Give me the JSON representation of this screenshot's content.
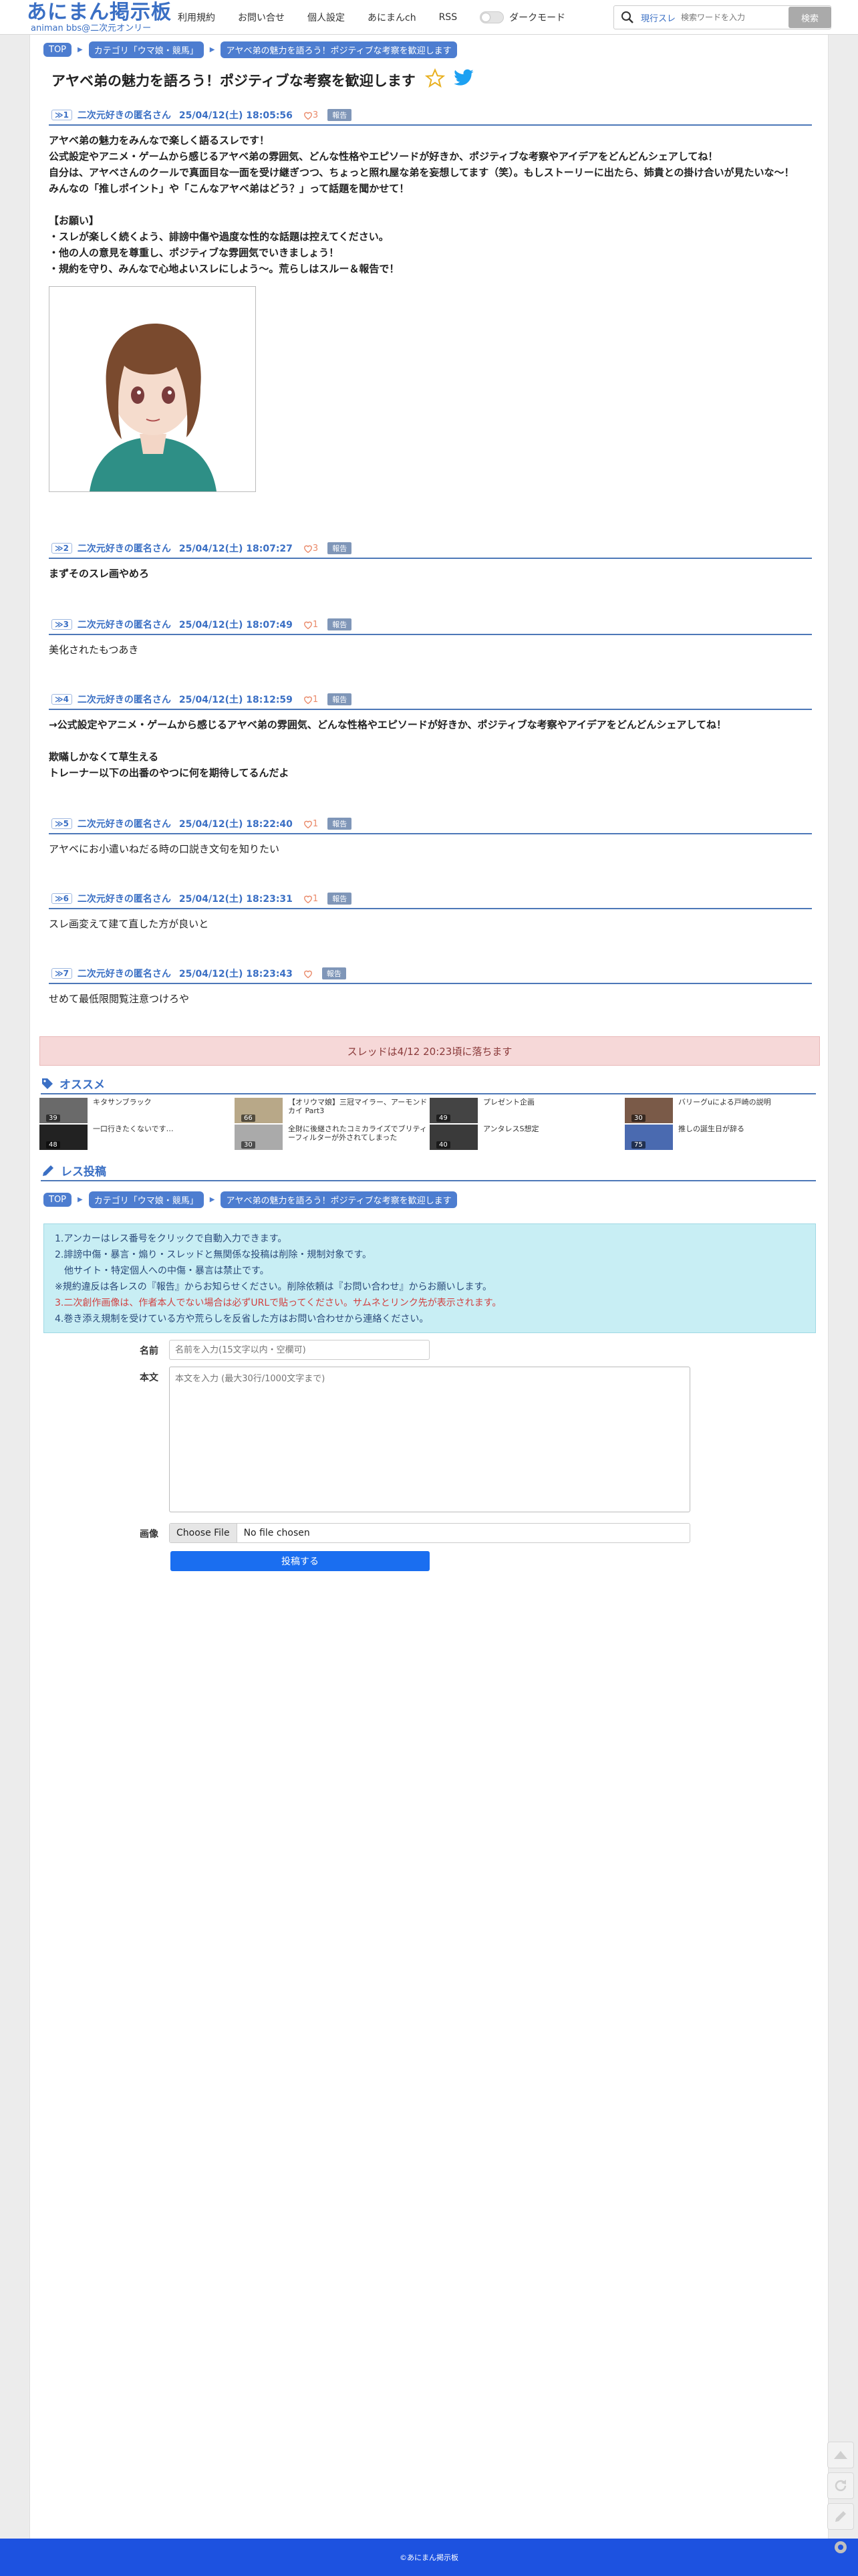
{
  "header": {
    "logo_main": "あにまん掲示板",
    "logo_sub": "animan bbs@二次元オンリー",
    "nav": [
      "利用規約",
      "お問い合せ",
      "個人設定",
      "あにまんch",
      "RSS"
    ],
    "dark_mode_label": "ダークモード",
    "search_mode": "現行スレ",
    "search_placeholder": "検索ワードを入力",
    "search_button": "検索"
  },
  "breadcrumbs": [
    "TOP",
    "カテゴリ「ウマ娘・競馬」",
    "アヤベ弟の魅力を語ろう！ポジティブな考察を歓迎します"
  ],
  "thread": {
    "title": "アヤベ弟の魅力を語ろう！ポジティブな考察を歓迎します"
  },
  "posts": [
    {
      "no": "≫1",
      "name": "二次元好きの匿名さん",
      "date": "25/04/12(土) 18:05:56",
      "likes": "3",
      "bold": true,
      "lines": [
        "アヤベ弟の魅力をみんなで楽しく語るスレです！",
        "公式設定やアニメ・ゲームから感じるアヤベ弟の雰囲気、どんな性格やエピソードが好きか、ポジティブな考察やアイデアをどんどんシェアしてね！",
        "自分は、アヤベさんのクールで真面目な一面を受け継ぎつつ、ちょっと照れ屋な弟を妄想してます（笑）。もしストーリーに出たら、姉貴との掛け合いが見たいな～！",
        "みんなの「推しポイント」や「こんなアヤベ弟はどう？」って話題を聞かせて！",
        "",
        "【お願い】",
        "・スレが楽しく続くよう、誹謗中傷や過度な性的な話題は控えてください。",
        "・他の人の意見を尊重し、ポジティブな雰囲気でいきましょう！",
        "・規約を守り、みんなで心地よいスレにしよう～。荒らしはスルー＆報告で！"
      ],
      "has_image": true
    },
    {
      "no": "≫2",
      "name": "二次元好きの匿名さん",
      "date": "25/04/12(土) 18:07:27",
      "likes": "3",
      "bold": true,
      "lines": [
        "まずそのスレ画やめろ"
      ]
    },
    {
      "no": "≫3",
      "name": "二次元好きの匿名さん",
      "date": "25/04/12(土) 18:07:49",
      "likes": "1",
      "bold": false,
      "lines": [
        "美化されたもつあき"
      ]
    },
    {
      "no": "≫4",
      "name": "二次元好きの匿名さん",
      "date": "25/04/12(土) 18:12:59",
      "likes": "1",
      "bold": true,
      "lines": [
        "→公式設定やアニメ・ゲームから感じるアヤベ弟の雰囲気、どんな性格やエピソードが好きか、ポジティブな考察やアイデアをどんどんシェアしてね！",
        "",
        "欺瞞しかなくて草生える",
        "トレーナー以下の出番のやつに何を期待してるんだよ"
      ]
    },
    {
      "no": "≫5",
      "name": "二次元好きの匿名さん",
      "date": "25/04/12(土) 18:22:40",
      "likes": "1",
      "bold": false,
      "lines": [
        "アヤベにお小遣いねだる時の口説き文句を知りたい"
      ]
    },
    {
      "no": "≫6",
      "name": "二次元好きの匿名さん",
      "date": "25/04/12(土) 18:23:31",
      "likes": "1",
      "bold": false,
      "lines": [
        "スレ画変えて建て直した方が良いと"
      ]
    },
    {
      "no": "≫7",
      "name": "二次元好きの匿名さん",
      "date": "25/04/12(土) 18:23:43",
      "likes": "",
      "bold": false,
      "lines": [
        "せめて最低限閲覧注意つけろや"
      ]
    }
  ],
  "report_label": "報告",
  "fallen_notice": "スレッドは4/12 20:23頃に落ちます",
  "recommend": {
    "title": "オススメ",
    "items": [
      {
        "title": "キタサンブラック",
        "count": "39",
        "color": "#6a6a6a"
      },
      {
        "title": "【オリウマ娘】三冠マイラー、アーモンドカイ Part3",
        "count": "66",
        "color": "#b8a888"
      },
      {
        "title": "プレゼント企画",
        "count": "49",
        "color": "#444444"
      },
      {
        "title": "バリーグuによる戸崎の説明",
        "count": "30",
        "color": "#7a5a48"
      },
      {
        "title": "一口行きたくないです…",
        "count": "48",
        "color": "#222222"
      },
      {
        "title": "全財に後継されたコミカライズでブリティーフィルターが外されてしまった",
        "count": "30",
        "color": "#aaaaaa"
      },
      {
        "title": "アンタレスS想定",
        "count": "40",
        "color": "#3a3a3a"
      },
      {
        "title": "推しの誕生日が辞る",
        "count": "75",
        "color": "#4a6ab0"
      }
    ]
  },
  "res_form": {
    "title": "レス投稿",
    "notice": [
      "1.アンカーはレス番号をクリックで自動入力できます。",
      "2.誹謗中傷・暴言・煽り・スレッドと無関係な投稿は削除・規制対象です。",
      "　他サイト・特定個人への中傷・暴言は禁止です。",
      "※規約違反は各レスの『報告』からお知らせください。削除依頼は『お問い合わせ』からお願いします。",
      "3.二次創作画像は、作者本人でない場合は必ずURLで貼ってください。サムネとリンク先が表示されます。",
      "4.巻き添え規制を受けている方や荒らしを反省した方はお問い合わせから連絡ください。"
    ],
    "name_label": "名前",
    "name_placeholder": "名前を入力(15文字以内・空欄可)",
    "body_label": "本文",
    "body_placeholder": "本文を入力 (最大30行/1000文字まで)",
    "image_label": "画像",
    "file_button": "Choose File",
    "file_status": "No file chosen",
    "submit": "投稿する"
  },
  "footer": "©あにまん掲示板",
  "colors": {
    "accent": "#3a6fc4",
    "footer": "#1d52e0",
    "submit": "#1a6ef0",
    "notice_bg": "#c8eef4",
    "fallen_bg": "#f6d8d8"
  }
}
